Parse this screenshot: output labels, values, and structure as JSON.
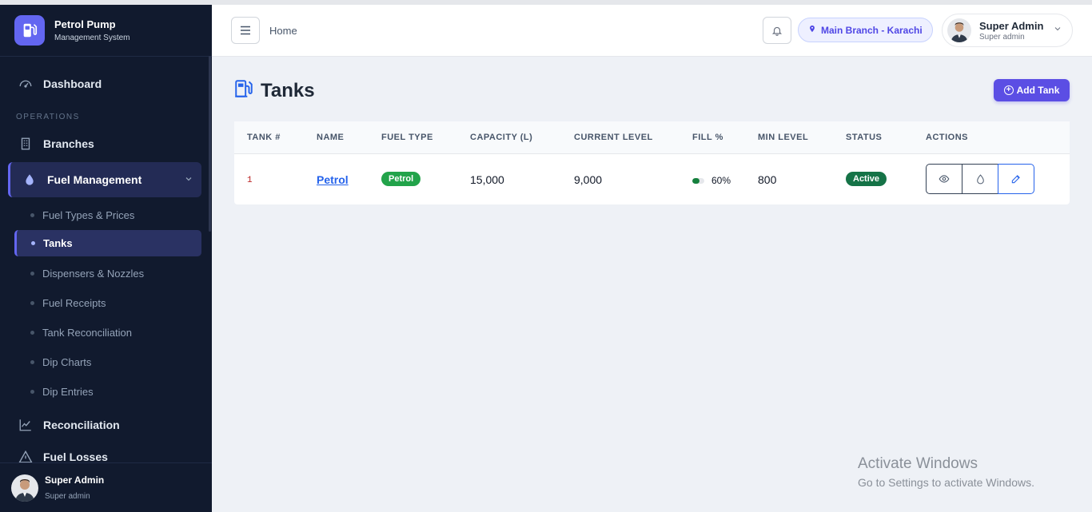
{
  "brand": {
    "title": "Petrol Pump",
    "subtitle": "Management System"
  },
  "sidebar": {
    "dashboard": "Dashboard",
    "section_operations": "OPERATIONS",
    "branches": "Branches",
    "fuel_management": "Fuel Management",
    "sub_items": [
      "Fuel Types & Prices",
      "Tanks",
      "Dispensers & Nozzles",
      "Fuel Receipts",
      "Tank Reconciliation",
      "Dip Charts",
      "Dip Entries"
    ],
    "reconciliation": "Reconciliation",
    "fuel_losses": "Fuel Losses",
    "footer_name": "Super Admin",
    "footer_role": "Super admin"
  },
  "header": {
    "breadcrumb": "Home",
    "branch": "Main Branch - Karachi",
    "user_name": "Super Admin",
    "user_role": "Super admin"
  },
  "page": {
    "title": "Tanks",
    "add_button": "Add Tank"
  },
  "table": {
    "columns": [
      "TANK #",
      "NAME",
      "FUEL TYPE",
      "CAPACITY (L)",
      "CURRENT LEVEL",
      "FILL %",
      "MIN LEVEL",
      "STATUS",
      "ACTIONS"
    ],
    "rows": [
      {
        "tank_no": "1",
        "name": "Petrol",
        "fuel_type": "Petrol",
        "capacity": "15,000",
        "current_level": "9,000",
        "fill": "60%",
        "fill_value": 0.6,
        "min_level": "800",
        "status": "Active"
      }
    ]
  },
  "watermark": {
    "line1": "Activate Windows",
    "line2": "Go to Settings to activate Windows."
  },
  "colors": {
    "accent": "#6366f1",
    "sidebar_bg": "#111a2e",
    "success": "#157347",
    "petrol_badge": "#22a34a"
  }
}
